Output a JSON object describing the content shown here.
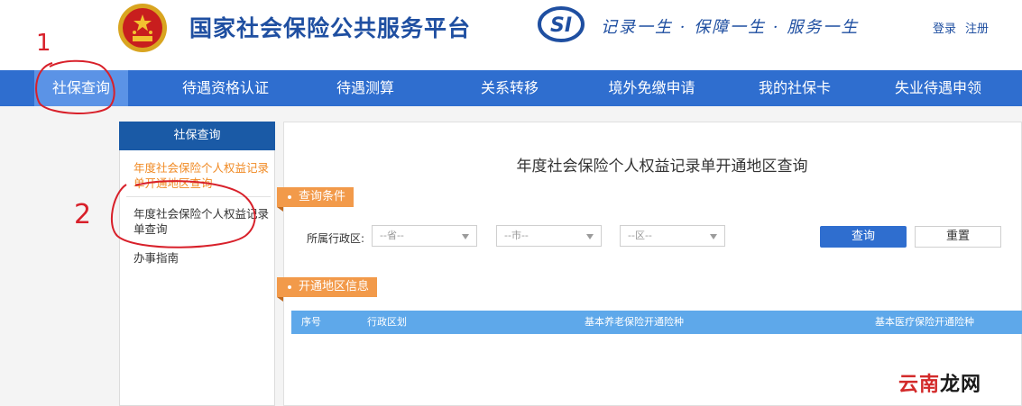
{
  "header": {
    "site_title": "国家社会保险公共服务平台",
    "logo_text": "SI",
    "slogan": "记录一生 · 保障一生 · 服务一生",
    "login": "登录",
    "register": "注册"
  },
  "nav": {
    "items": [
      "社保查询",
      "待遇资格认证",
      "待遇测算",
      "关系转移",
      "境外免缴申请",
      "我的社保卡",
      "失业待遇申领"
    ],
    "active_index": 0
  },
  "sidebar": {
    "title": "社保查询",
    "items": [
      {
        "label": "年度社会保险个人权益记录单开通地区查询",
        "state": "active"
      },
      {
        "label": "年度社会保险个人权益记录单查询",
        "state": "normal"
      },
      {
        "label": "办事指南",
        "state": "normal"
      }
    ]
  },
  "main": {
    "title": "年度社会保险个人权益记录单开通地区查询",
    "query_section": "查询条件",
    "filter_label": "所属行政区:",
    "province_select": "--省--",
    "city_select": "--市--",
    "district_select": "--区--",
    "query_button": "查询",
    "reset_button": "重置",
    "info_section": "开通地区信息",
    "table_headers": [
      "序号",
      "行政区划",
      "基本养老保险开通险种",
      "基本医疗保险开通险种"
    ]
  },
  "annotations": {
    "mark_1": "1",
    "mark_2": "2"
  },
  "watermark": {
    "part1": "云南",
    "part2": "龙网"
  },
  "colors": {
    "brand_blue": "#1f4fa1",
    "nav_blue": "#2f6ecf",
    "nav_active": "#5b93e6",
    "sidebar_head": "#1a5aa6",
    "tag_orange": "#f29a4a",
    "table_head": "#5ea8ea",
    "annotation_red": "#d8202a"
  }
}
